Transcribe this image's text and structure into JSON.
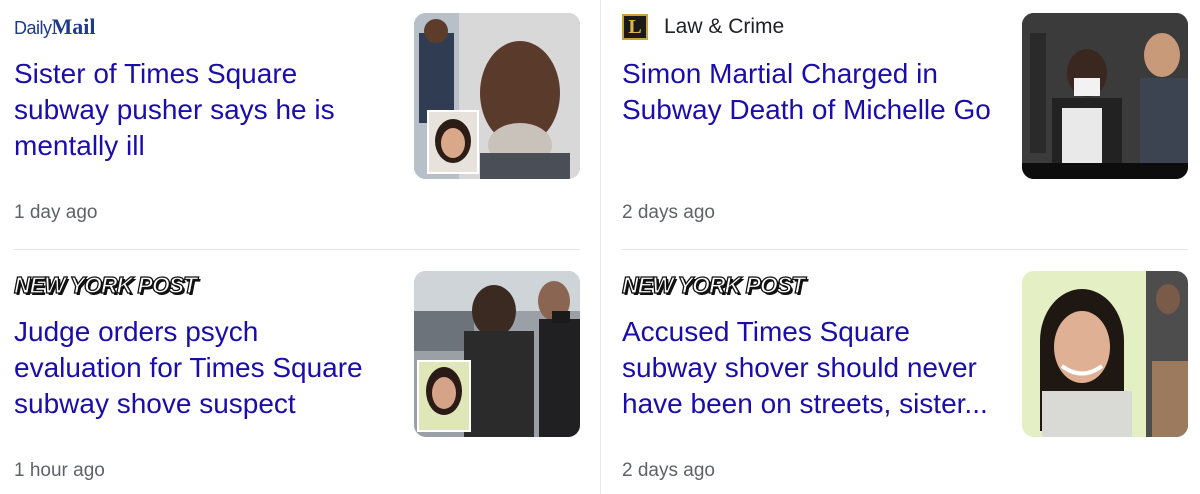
{
  "cards": [
    {
      "source": "Daily Mail",
      "source_logo": {
        "part1": "Daily",
        "part2": "Mail"
      },
      "headline": "Sister of Times Square subway pusher says he is mentally ill",
      "time": "1 day ago",
      "thumbnail_icon": "news-photo-icon"
    },
    {
      "source": "Law & Crime",
      "source_logo": {
        "mark": "L"
      },
      "headline": "Simon Martial Charged in Subway Death of Michelle Go",
      "time": "2 days ago",
      "thumbnail_icon": "news-photo-icon"
    },
    {
      "source": "NEW YORK POST",
      "headline": "Judge orders psych evaluation for Times Square subway shove suspect",
      "time": "1 hour ago",
      "thumbnail_icon": "news-photo-icon"
    },
    {
      "source": "NEW YORK POST",
      "headline": "Accused Times Square subway shover should never have been on streets, sister...",
      "time": "2 days ago",
      "thumbnail_icon": "news-photo-icon"
    }
  ],
  "colors": {
    "headline": "#1a0dab",
    "time": "#5f6368",
    "daily_mail": "#1f3a8a"
  }
}
